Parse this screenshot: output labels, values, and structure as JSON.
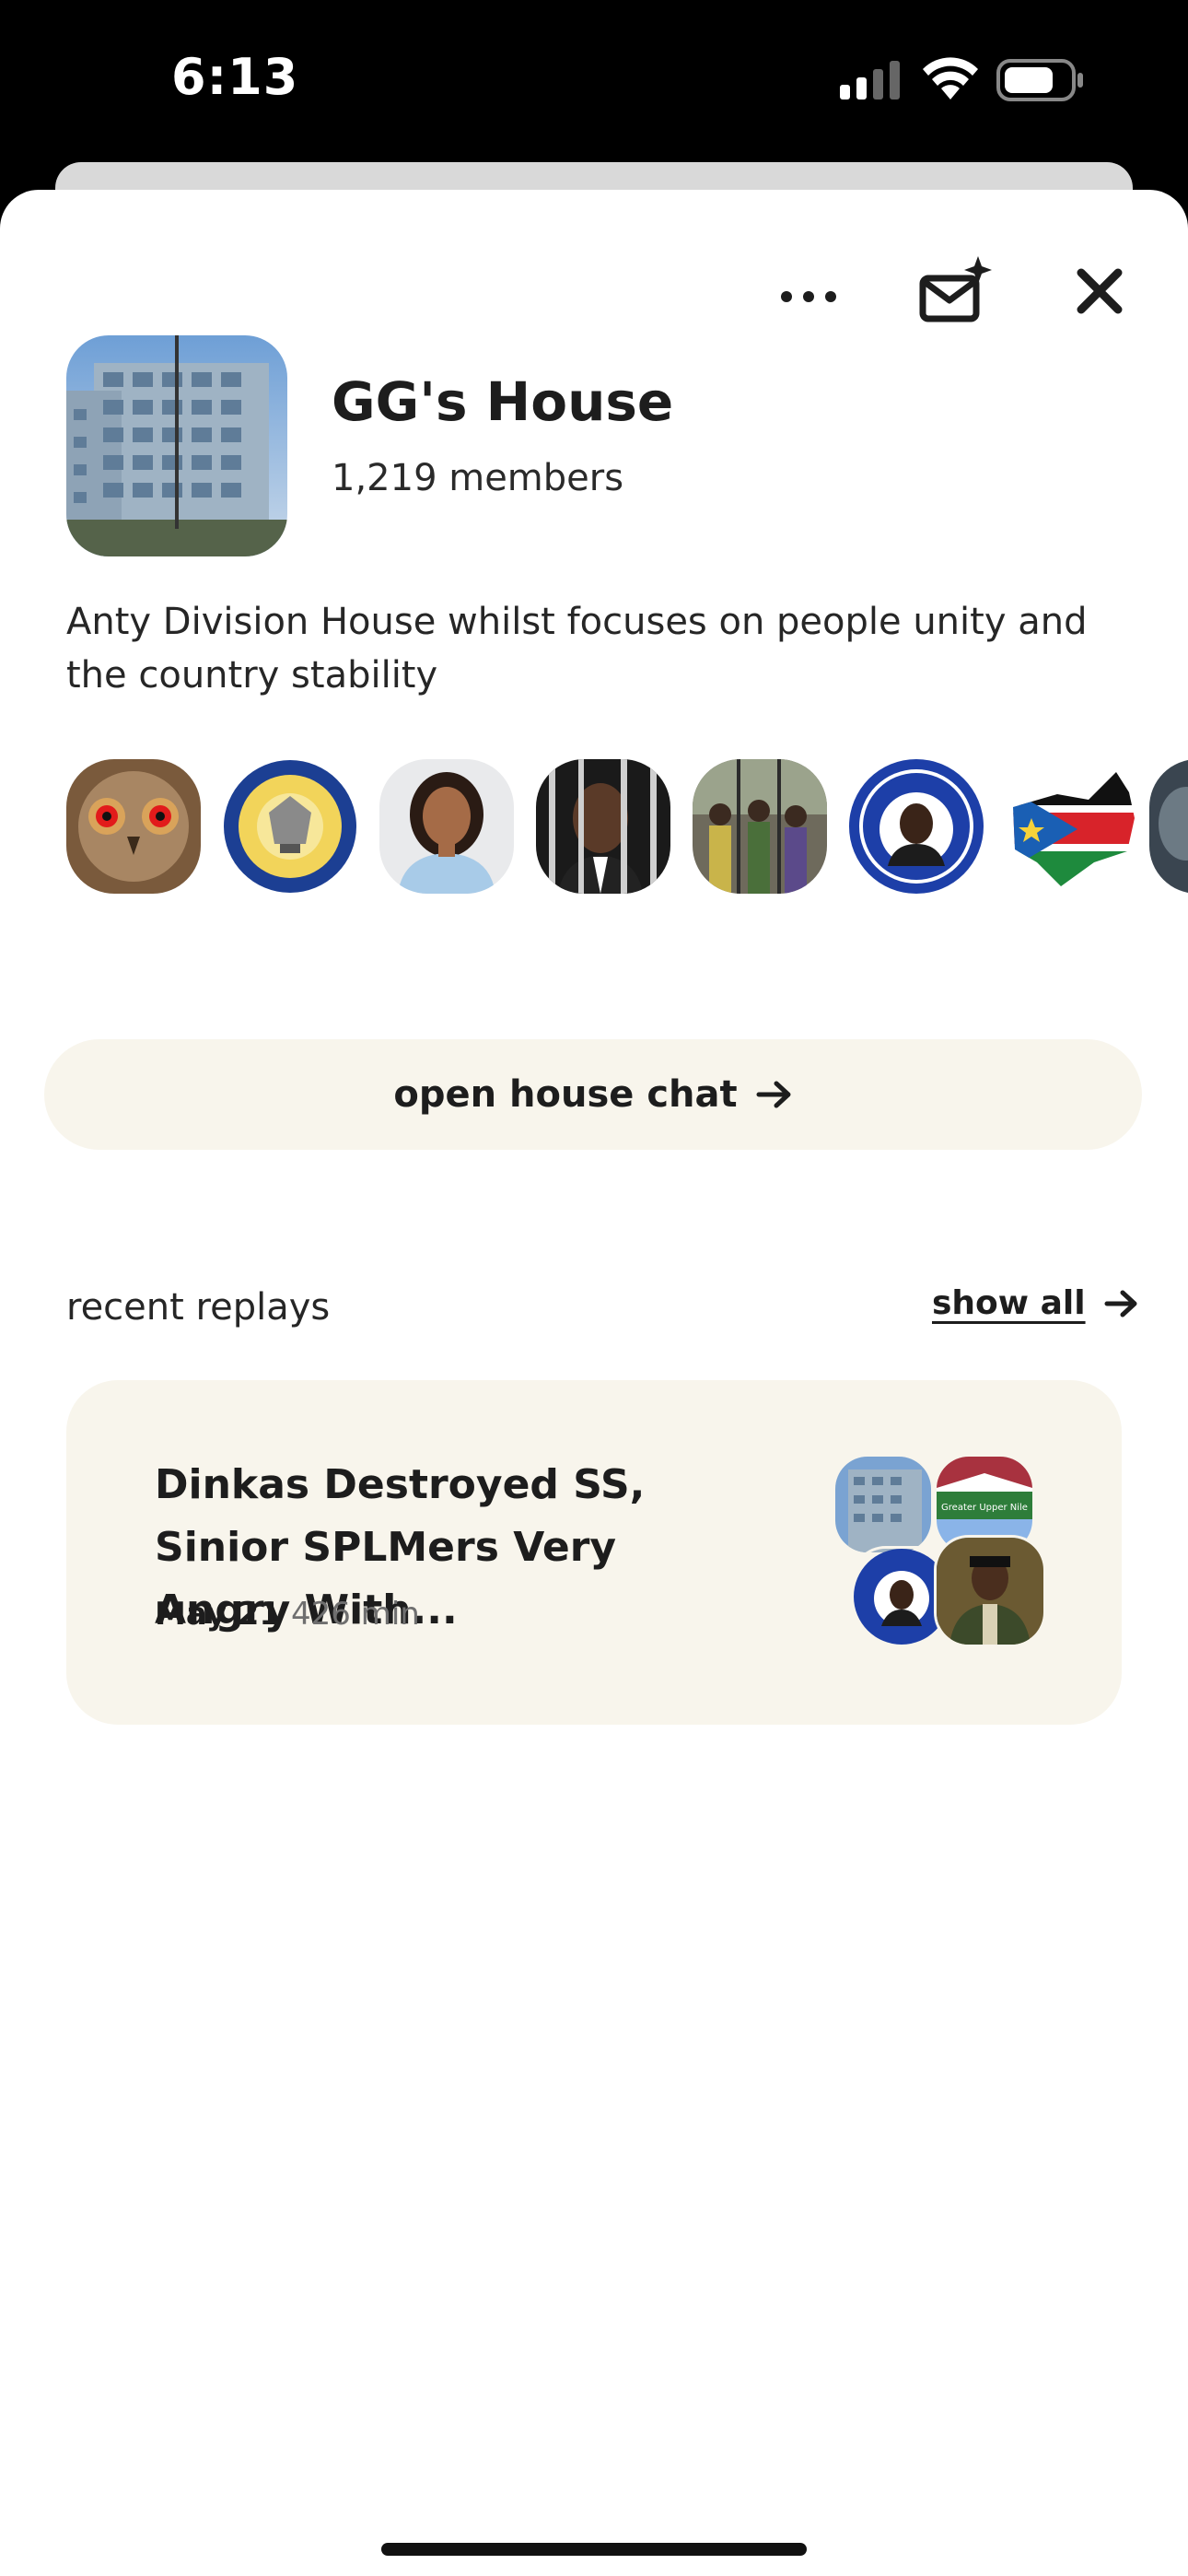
{
  "status_bar": {
    "time": "6:13"
  },
  "house": {
    "name": "GG's House",
    "members": "1,219 members",
    "description": "Anty Division House whilst focuses on people unity and the country stability"
  },
  "actions": {
    "more_icon": "ellipsis-icon",
    "invite_icon": "mail-sparkle-icon",
    "close_icon": "close-icon"
  },
  "member_avatars": [
    {
      "name": "owl-avatar"
    },
    {
      "name": "seal-avatar"
    },
    {
      "name": "woman-avatar"
    },
    {
      "name": "man-bars-avatar"
    },
    {
      "name": "crowd-avatar"
    },
    {
      "name": "free-dr-machar-avatar"
    },
    {
      "name": "south-sudan-map-avatar"
    },
    {
      "name": "partial-avatar"
    }
  ],
  "chat_button": {
    "label": "open house chat"
  },
  "recent": {
    "label": "recent replays",
    "show_all": "show all",
    "replays": [
      {
        "title": "Dinkas Destroyed SS, Sinior SPLMers Very Angry With...",
        "date": "May 21",
        "duration": "426 min",
        "mini_avatar_4_text": "Greater Upper Nile"
      }
    ]
  },
  "colors": {
    "sheet_bg": "#ffffff",
    "cream": "#f8f5ec",
    "text": "#1d1d1d"
  }
}
